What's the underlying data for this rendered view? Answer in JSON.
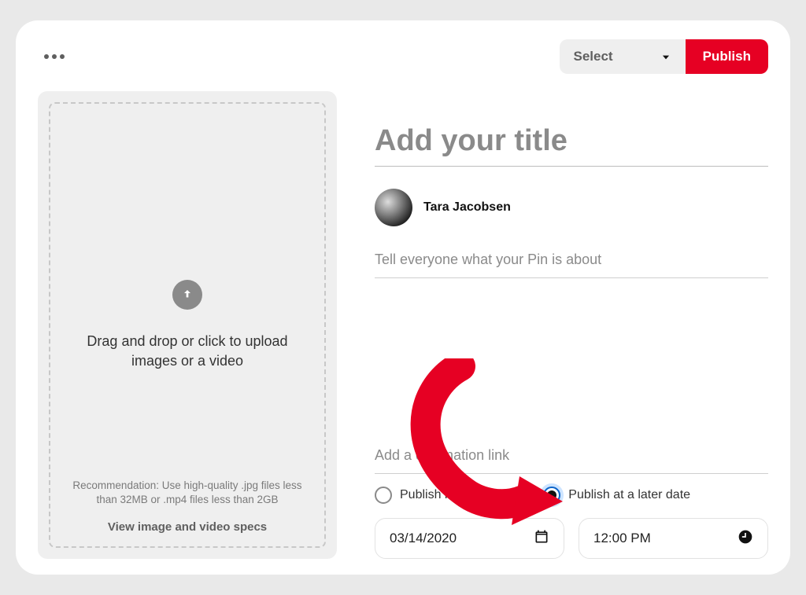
{
  "topbar": {
    "board_select_label": "Select",
    "publish_label": "Publish"
  },
  "dropzone": {
    "main_text": "Drag and drop or click to upload images or a video",
    "recommendation": "Recommendation: Use high-quality .jpg files less than 32MB or .mp4 files less than 2GB",
    "specs_link": "View image and video specs"
  },
  "form": {
    "title_placeholder": "Add your title",
    "author_name": "Tara Jacobsen",
    "description_placeholder": "Tell everyone what your Pin is about",
    "destination_placeholder": "Add a destination link"
  },
  "schedule": {
    "option_immediate": "Publish immediately",
    "option_later": "Publish at a later date",
    "selected": "later",
    "date_value": "03/14/2020",
    "time_value": "12:00 PM"
  },
  "colors": {
    "brand_red": "#e60023"
  }
}
